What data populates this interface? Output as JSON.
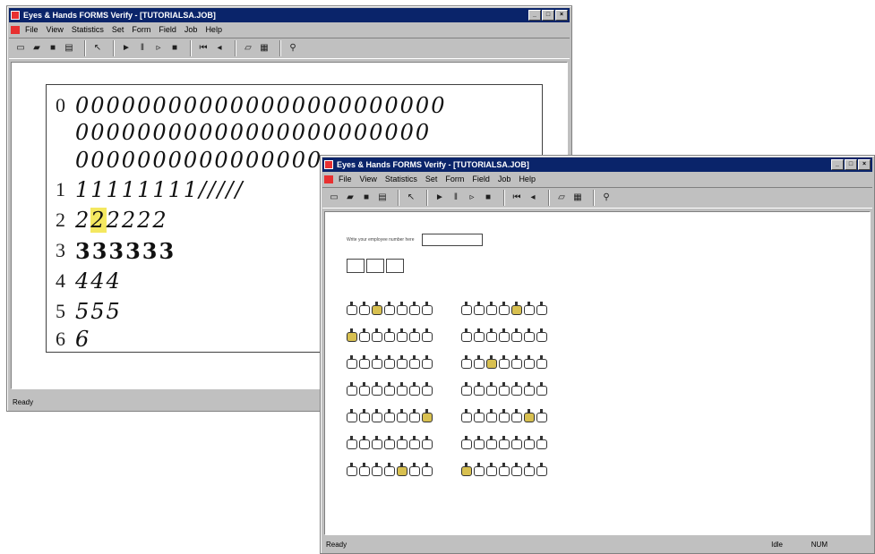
{
  "window_back": {
    "title": "Eyes & Hands FORMS Verify - [TUTORIALSA.JOB]",
    "menu": [
      "File",
      "View",
      "Statistics",
      "Set",
      "Form",
      "Field",
      "Job",
      "Help"
    ],
    "status": "Ready",
    "rows": [
      {
        "label": "0",
        "lines": [
          "000000000000000000000000",
          "00000000000000000000000",
          "0000000000000000"
        ]
      },
      {
        "label": "1",
        "lines": [
          "11111111/////"
        ]
      },
      {
        "label": "2",
        "lines": [
          "222222"
        ]
      },
      {
        "label": "3",
        "lines": [
          "333333"
        ]
      },
      {
        "label": "4",
        "lines": [
          "444"
        ]
      },
      {
        "label": "5",
        "lines": [
          "555"
        ]
      },
      {
        "label": "6",
        "lines": [
          "6"
        ]
      }
    ]
  },
  "window_front": {
    "title": "Eyes & Hands FORMS Verify - [TUTORIALSA.JOB]",
    "menu": [
      "File",
      "View",
      "Statistics",
      "Set",
      "Form",
      "Field",
      "Job",
      "Help"
    ],
    "field_label": "Write your employee number here",
    "status": "Ready",
    "status_idle": "Idle",
    "status_num": "NUM",
    "bubble_rows": [
      {
        "left": [
          0,
          0,
          1,
          0,
          0,
          0,
          0
        ],
        "right": [
          0,
          0,
          0,
          0,
          1,
          0,
          0
        ]
      },
      {
        "left": [
          1,
          0,
          0,
          0,
          0,
          0,
          0
        ],
        "right": [
          0,
          0,
          0,
          0,
          0,
          0,
          0
        ]
      },
      {
        "left": [
          0,
          0,
          0,
          0,
          0,
          0,
          0
        ],
        "right": [
          0,
          0,
          1,
          0,
          0,
          0,
          0
        ]
      },
      {
        "left": [
          0,
          0,
          0,
          0,
          0,
          0,
          0
        ],
        "right": [
          0,
          0,
          0,
          0,
          0,
          0,
          0
        ]
      },
      {
        "left": [
          0,
          0,
          0,
          0,
          0,
          0,
          1
        ],
        "right": [
          0,
          0,
          0,
          0,
          0,
          1,
          0
        ]
      },
      {
        "left": [
          0,
          0,
          0,
          0,
          0,
          0,
          0
        ],
        "right": [
          0,
          0,
          0,
          0,
          0,
          0,
          0
        ]
      },
      {
        "left": [
          0,
          0,
          0,
          0,
          1,
          0,
          0
        ],
        "right": [
          1,
          0,
          0,
          0,
          0,
          0,
          0
        ]
      }
    ]
  },
  "toolbar_icons": [
    "new-icon",
    "open-icon",
    "save-icon",
    "print-icon",
    "help-icon",
    "play-icon",
    "pause-icon",
    "step-icon",
    "stop-icon",
    "first-icon",
    "prev-icon",
    "edit-icon",
    "list-icon",
    "find-icon"
  ]
}
